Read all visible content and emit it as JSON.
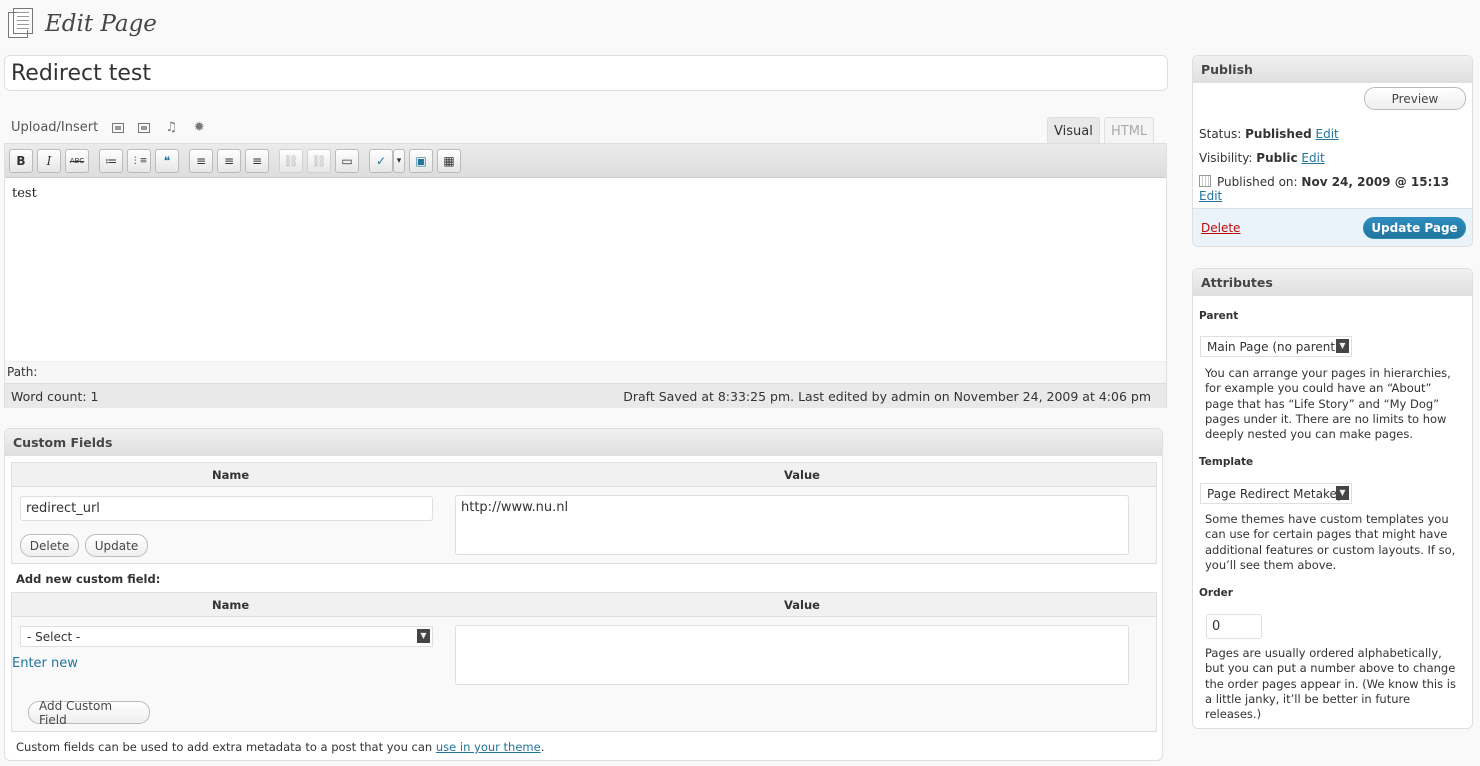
{
  "header": {
    "title": "Edit Page"
  },
  "post": {
    "title": "Redirect test",
    "content": "test"
  },
  "media": {
    "label": "Upload/Insert"
  },
  "tabs": {
    "visual": "Visual",
    "html": "HTML"
  },
  "toolbar": {
    "buttons": [
      "B",
      "I",
      "ABC",
      "≔",
      "⋮≡",
      "❝",
      "≡",
      "≡",
      "≡",
      "⛓",
      "⛓",
      "▭",
      "✓",
      "▾",
      "▣",
      "▦"
    ]
  },
  "editor": {
    "path_label": "Path:",
    "word_count": "Word count: 1",
    "status": "Draft Saved at 8:33:25 pm. Last edited by admin on November 24, 2009 at 4:06 pm"
  },
  "custom_fields": {
    "title": "Custom Fields",
    "col_name": "Name",
    "col_value": "Value",
    "existing": {
      "name": "redirect_url",
      "value": "http://www.nu.nl"
    },
    "delete_label": "Delete",
    "update_label": "Update",
    "add_new_label": "Add new custom field:",
    "select_value": "- Select -",
    "enter_new": "Enter new",
    "add_button": "Add Custom Field",
    "footer_text": "Custom fields can be used to add extra metadata to a post that you can ",
    "footer_link": "use in your theme",
    "footer_end": "."
  },
  "publish": {
    "title": "Publish",
    "preview": "Preview",
    "status_label": "Status:",
    "status_value": "Published",
    "visibility_label": "Visibility:",
    "visibility_value": "Public",
    "published_label": "Published on:",
    "published_value": "Nov 24, 2009 @ 15:13",
    "edit": "Edit",
    "delete": "Delete",
    "update": "Update Page"
  },
  "attributes": {
    "title": "Attributes",
    "parent_label": "Parent",
    "parent_value": "Main Page (no parent)",
    "parent_help": "You can arrange your pages in hierarchies, for example you could have an “About” page that has “Life Story” and “My Dog” pages under it. There are no limits to how deeply nested you can make pages.",
    "template_label": "Template",
    "template_value": "Page Redirect Metakey",
    "template_help": "Some themes have custom templates you can use for certain pages that might have additional features or custom layouts. If so, you’ll see them above.",
    "order_label": "Order",
    "order_value": "0",
    "order_help": "Pages are usually ordered alphabetically, but you can put a number above to change the order pages appear in. (We know this is a little janky, it’ll be better in future releases.)"
  }
}
